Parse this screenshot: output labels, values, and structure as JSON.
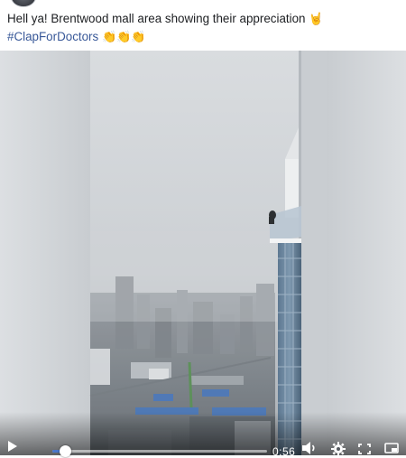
{
  "post": {
    "text_line1": "Hell ya! Brentwood mall area showing their appreciation",
    "emoji_line1": "🤘",
    "hashtag": "#ClapForDoctors",
    "emoji_line2": "👏👏👏"
  },
  "video": {
    "time_label": "0:56",
    "progress": 0.06,
    "icons": [
      "play-icon",
      "volume-icon",
      "gear-icon",
      "fullscreen-icon",
      "more-icon"
    ]
  }
}
